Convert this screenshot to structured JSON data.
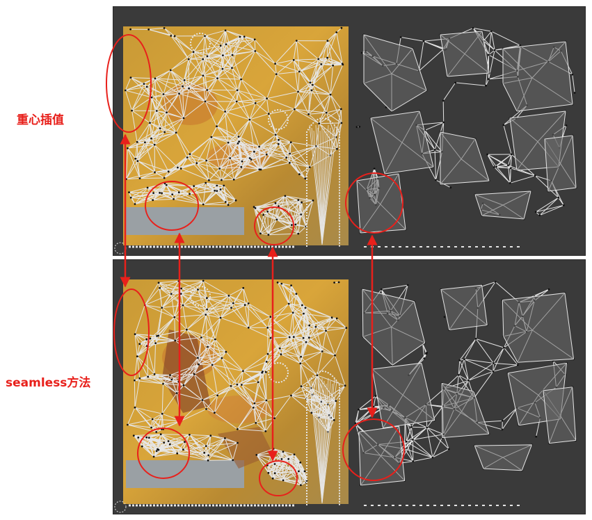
{
  "labels": {
    "top": "重心插值",
    "bottom": "seamless方法"
  },
  "colors": {
    "background": "#ffffff",
    "panel": "#3a3a3a",
    "annotation": "#e8201b",
    "wire": "#e6e6e6",
    "vertex": "#111111",
    "texture_gold": "#d9a53a",
    "texture_orange": "#c8782f",
    "shell_fill": "#6a6a6a"
  }
}
